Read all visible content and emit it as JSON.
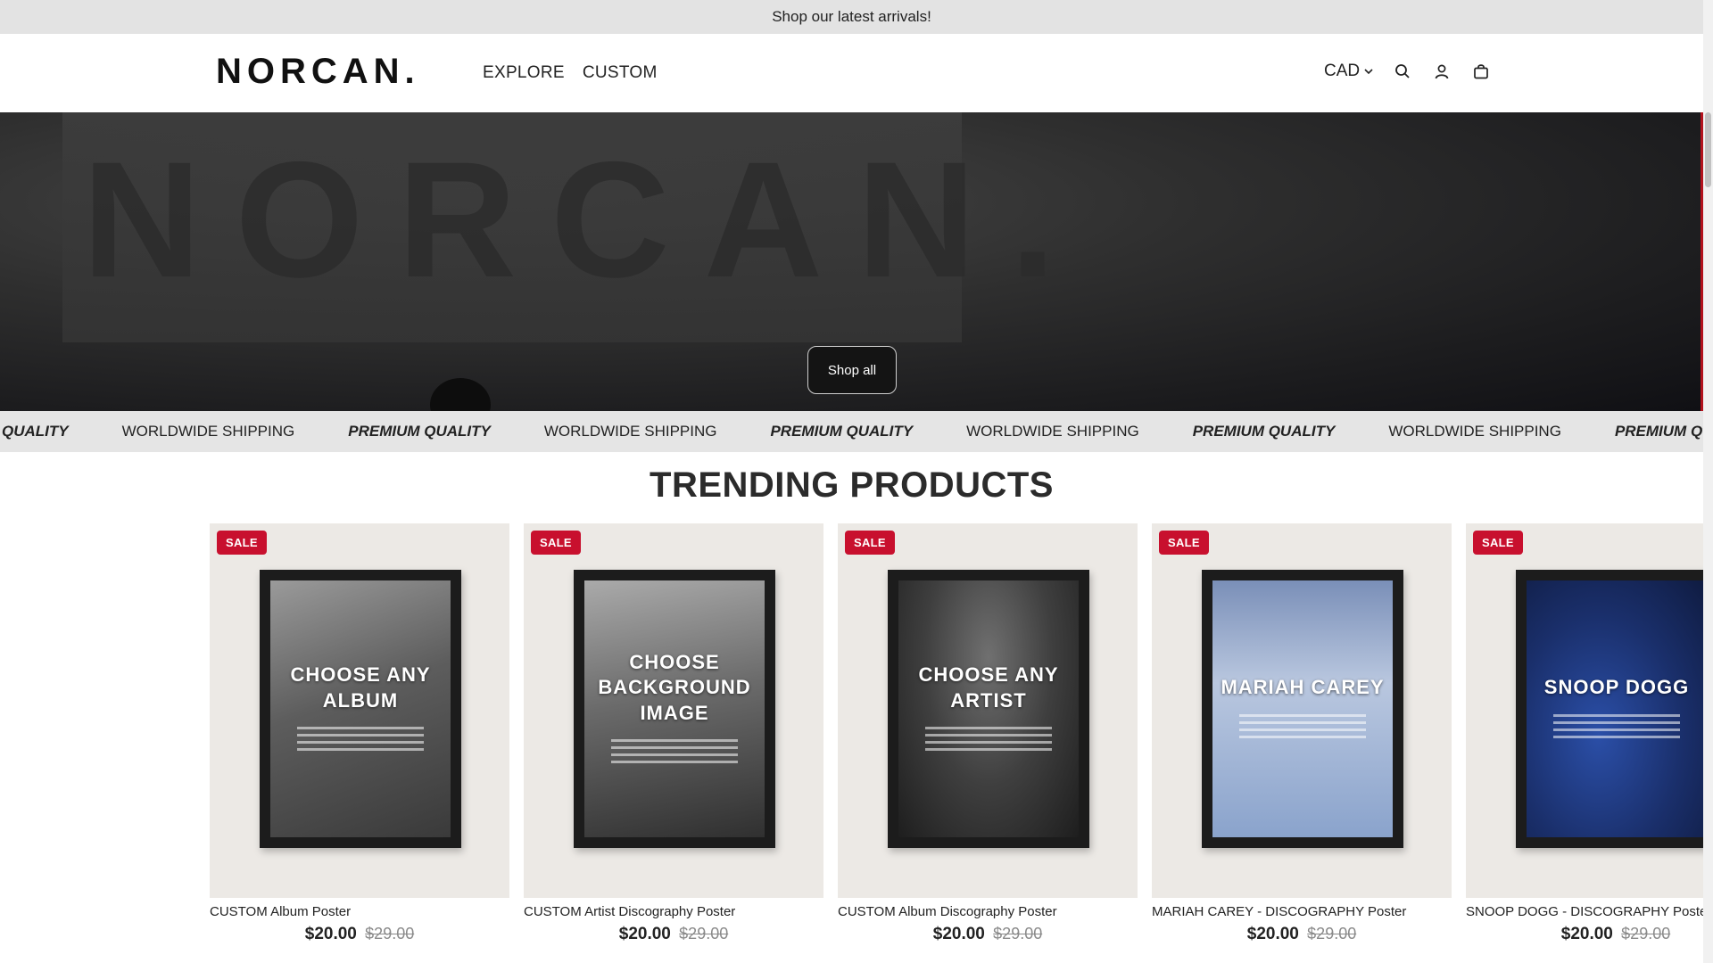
{
  "announcement": "Shop our latest arrivals!",
  "header": {
    "logo": "NORCAN.",
    "nav": [
      "EXPLORE",
      "CUSTOM"
    ],
    "currency": "CAD",
    "icons": [
      "search-icon",
      "account-icon",
      "cart-icon"
    ]
  },
  "hero": {
    "backdrop_word": "NORCAN.",
    "button_label": "Shop all"
  },
  "marquee": {
    "items": [
      "QUALITY",
      "WORLDWIDE SHIPPING",
      "PREMIUM QUALITY",
      "WORLDWIDE SHIPPING",
      "PREMIUM QUALITY",
      "WORLDWIDE SHIPPING",
      "PREMIUM QUALITY",
      "WORLDWIDE SHIPPING",
      "PREMIUM QUALITY"
    ]
  },
  "trending": {
    "title": "TRENDING PRODUCTS",
    "products": [
      {
        "badge": "SALE",
        "name": "CUSTOM Album Poster",
        "price": "$20.00",
        "compare_price": "$29.00",
        "poster_text": "CHOOSE ANY ALBUM"
      },
      {
        "badge": "SALE",
        "name": "CUSTOM Artist Discography Poster",
        "price": "$20.00",
        "compare_price": "$29.00",
        "poster_text": "CHOOSE BACKGROUND IMAGE"
      },
      {
        "badge": "SALE",
        "name": "CUSTOM Album Discography Poster",
        "price": "$20.00",
        "compare_price": "$29.00",
        "poster_text": "CHOOSE ANY ARTIST"
      },
      {
        "badge": "SALE",
        "name": "MARIAH CAREY - DISCOGRAPHY Poster",
        "price": "$20.00",
        "compare_price": "$29.00",
        "poster_text": "MARIAH CAREY"
      },
      {
        "badge": "SALE",
        "name": "SNOOP DOGG - DISCOGRAPHY Poster",
        "price": "$20.00",
        "compare_price": "$29.00",
        "poster_text": "SNOOP DOGG"
      }
    ]
  },
  "colors": {
    "announcement_bg": "#e3e3e3",
    "sale_badge": "#c8102e",
    "marquee_bg": "#e5e5e5",
    "hero_dark": "#1c1c1e"
  }
}
